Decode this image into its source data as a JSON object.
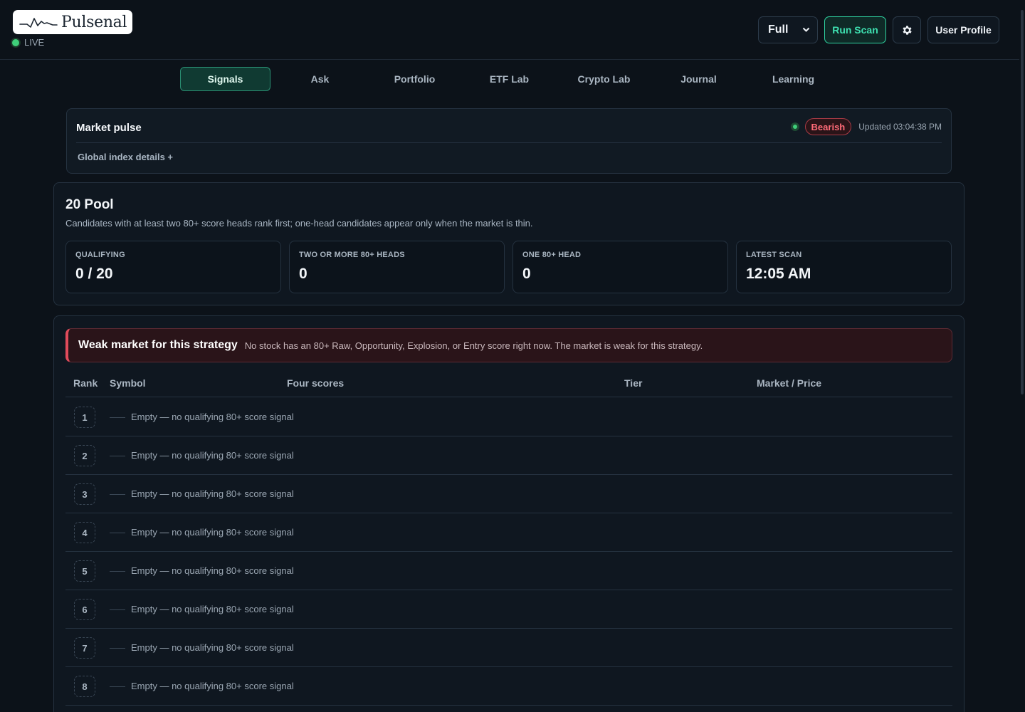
{
  "header": {
    "brand": "Pulsenal",
    "live_label": "LIVE",
    "mode_select": "Full",
    "run_scan": "Run Scan",
    "user_profile": "User Profile"
  },
  "tabs": [
    {
      "label": "Signals",
      "active": true
    },
    {
      "label": "Ask"
    },
    {
      "label": "Portfolio"
    },
    {
      "label": "ETF Lab"
    },
    {
      "label": "Crypto Lab"
    },
    {
      "label": "Journal"
    },
    {
      "label": "Learning"
    }
  ],
  "market_pulse": {
    "title": "Market pulse",
    "sentiment": "Bearish",
    "updated": "Updated 03:04:38 PM",
    "details_link": "Global index details +"
  },
  "pool": {
    "title": "20 Pool",
    "description": "Candidates with at least two 80+ score heads rank first; one-head candidates appear only when the market is thin.",
    "stats": [
      {
        "label": "QUALIFYING",
        "value": "0 / 20"
      },
      {
        "label": "TWO OR MORE 80+ HEADS",
        "value": "0"
      },
      {
        "label": "ONE 80+ HEAD",
        "value": "0"
      },
      {
        "label": "LATEST SCAN",
        "value": "12:05 AM"
      }
    ]
  },
  "signals": {
    "alert_title": "Weak market for this strategy",
    "alert_text": "No stock has an 80+ Raw, Opportunity, Explosion, or Entry score right now. The market is weak for this strategy.",
    "columns": {
      "rank": "Rank",
      "symbol": "Symbol",
      "scores": "Four scores",
      "tier": "Tier",
      "market": "Market / Price"
    },
    "rows": [
      {
        "rank": "1",
        "text": "Empty — no qualifying 80+ score signal"
      },
      {
        "rank": "2",
        "text": "Empty — no qualifying 80+ score signal"
      },
      {
        "rank": "3",
        "text": "Empty — no qualifying 80+ score signal"
      },
      {
        "rank": "4",
        "text": "Empty — no qualifying 80+ score signal"
      },
      {
        "rank": "5",
        "text": "Empty — no qualifying 80+ score signal"
      },
      {
        "rank": "6",
        "text": "Empty — no qualifying 80+ score signal"
      },
      {
        "rank": "7",
        "text": "Empty — no qualifying 80+ score signal"
      },
      {
        "rank": "8",
        "text": "Empty — no qualifying 80+ score signal"
      }
    ]
  },
  "colors": {
    "background": "#0c1219",
    "accent": "#3ee0b0",
    "bearish": "#ff6b78",
    "live": "#3fcf7a"
  }
}
